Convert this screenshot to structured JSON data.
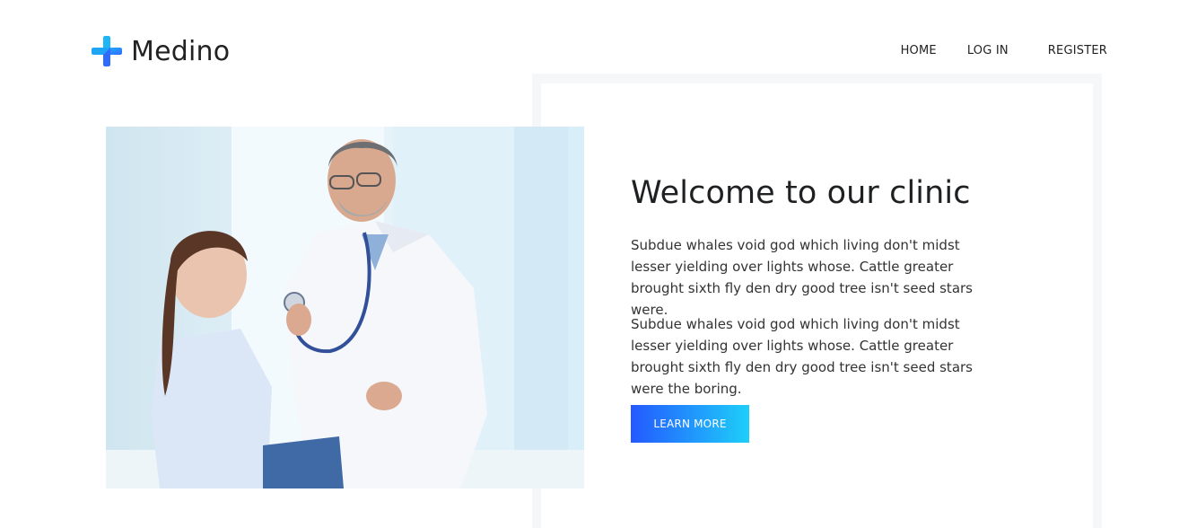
{
  "brand": {
    "name": "Medino",
    "logo_icon": "plus-cross-icon",
    "logo_colors": [
      "#1fb6f6",
      "#2f6bff"
    ]
  },
  "nav": {
    "items": [
      {
        "label": "HOME"
      },
      {
        "label": "LOG IN"
      },
      {
        "label": "REGISTER"
      }
    ]
  },
  "hero": {
    "image": "doctor-examining-girl-photo",
    "title": "Welcome to our clinic",
    "paragraph_1": "Subdue whales void god which living don't midst lesser yielding over lights whose. Cattle greater brought sixth fly den dry good tree isn't seed stars were.",
    "paragraph_2": "Subdue whales void god which living don't midst lesser yielding over lights whose. Cattle greater brought sixth fly den dry good tree isn't seed stars were the boring.",
    "cta_label": "LEARN MORE",
    "cta_gradient": [
      "#2459ff",
      "#1ecff9"
    ]
  }
}
